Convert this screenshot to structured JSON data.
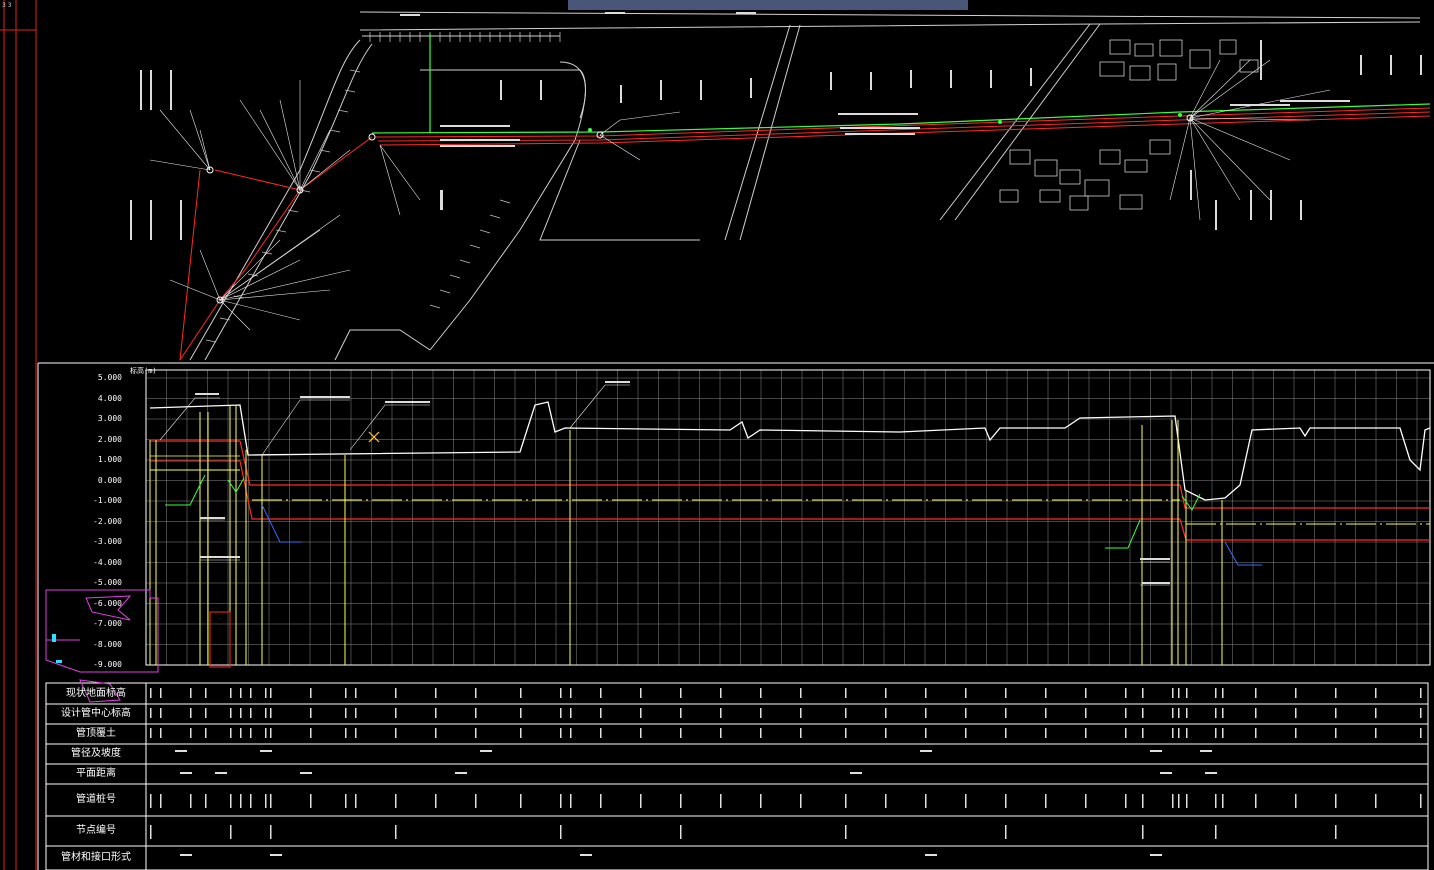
{
  "colors": {
    "background": "#000000",
    "grid": "#8a8a8a",
    "profile_line": "#ffffff",
    "pipe_red": "#ff2a2a",
    "pipe_green": "#3cff3c",
    "guide_yellow": "#ffff55",
    "dimension_blue": "#3a6bff",
    "title_block_magenta": "#e040e0",
    "header_bar": "#4a5678"
  },
  "profile": {
    "y_axis_labels": [
      "5.000",
      "4.000",
      "3.000",
      "2.000",
      "1.000",
      "0.000",
      "-1.000",
      "-2.000",
      "-3.000",
      "-4.000",
      "-5.000",
      "-6.000",
      "-7.000",
      "-8.000",
      "-9.000"
    ],
    "corner_label": "标高(m)"
  },
  "table": {
    "row_labels": [
      "现状地面标高",
      "设计管中心标高",
      "管顶覆土",
      "管径及坡度",
      "平面距离",
      "管道桩号",
      "节点编号",
      "管材和接口形式"
    ]
  },
  "left_tab": {
    "label": "3  3"
  },
  "icons": [
    "profile-grid-icon",
    "pipe-plan-icon",
    "marker-x-icon",
    "title-block-icon"
  ]
}
